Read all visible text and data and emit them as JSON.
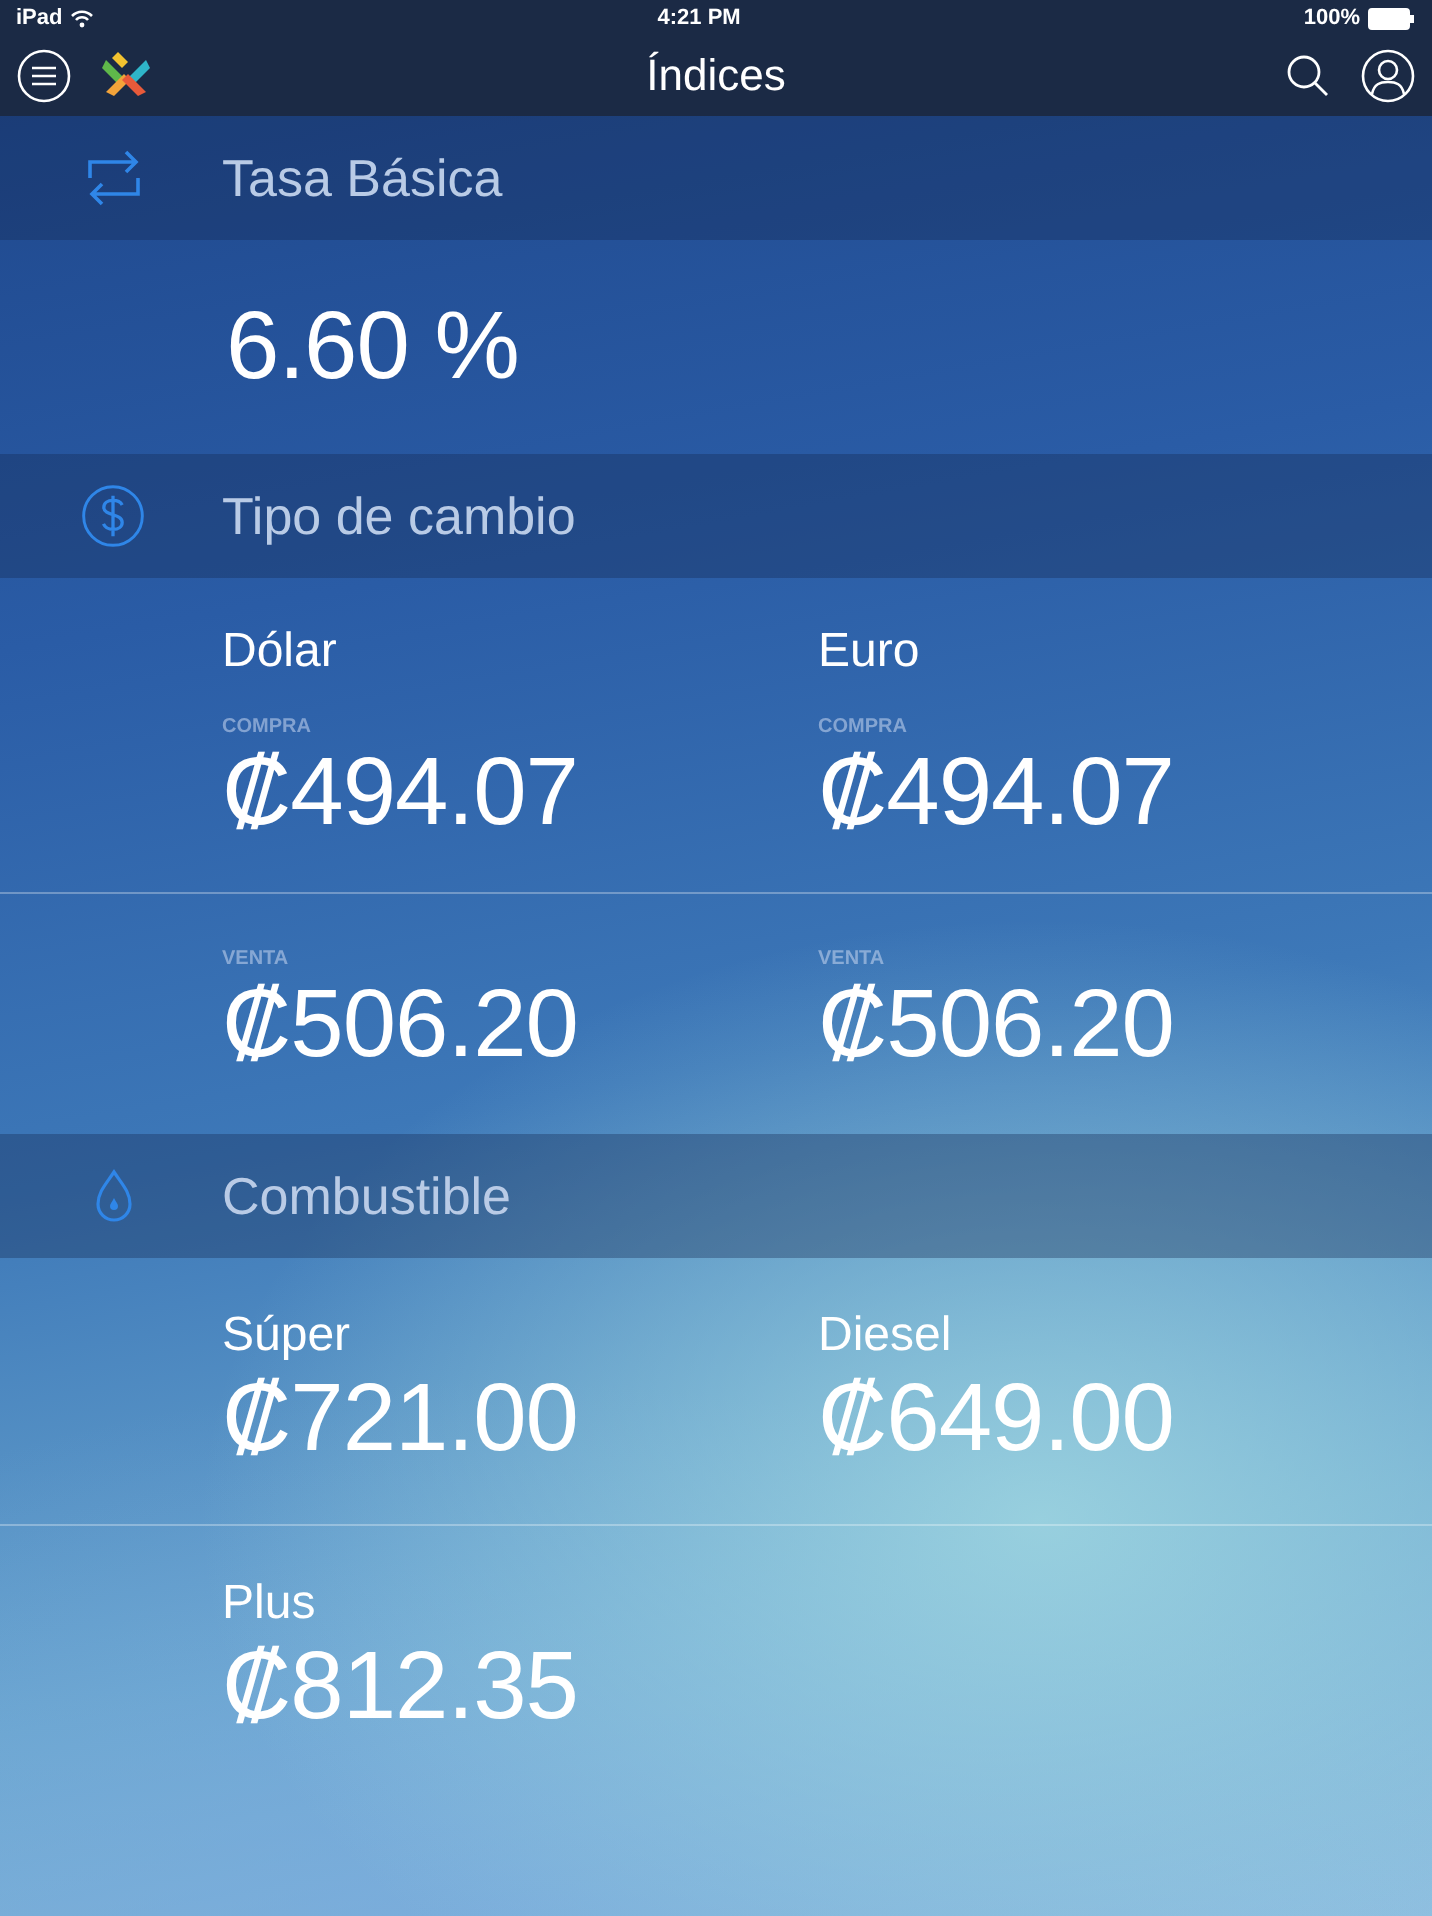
{
  "status_bar": {
    "device": "iPad",
    "time": "4:21 PM",
    "battery": "100%"
  },
  "nav": {
    "title": "Índices"
  },
  "sections": [
    {
      "kind": "rate",
      "title": "Tasa Básica",
      "value": "6.60 %"
    },
    {
      "kind": "exchange",
      "title": "Tipo de cambio",
      "currencies": [
        {
          "name": "Dólar",
          "buy_label": "COMPRA",
          "buy": "₡494.07",
          "sell_label": "VENTA",
          "sell": "₡506.20"
        },
        {
          "name": "Euro",
          "buy_label": "COMPRA",
          "buy": "₡494.07",
          "sell_label": "VENTA",
          "sell": "₡506.20"
        }
      ]
    },
    {
      "kind": "fuel",
      "title": "Combustible",
      "items": [
        {
          "name": "Súper",
          "price": "₡721.00"
        },
        {
          "name": "Diesel",
          "price": "₡649.00"
        },
        {
          "name": "Plus",
          "price": "₡812.35"
        }
      ]
    }
  ]
}
